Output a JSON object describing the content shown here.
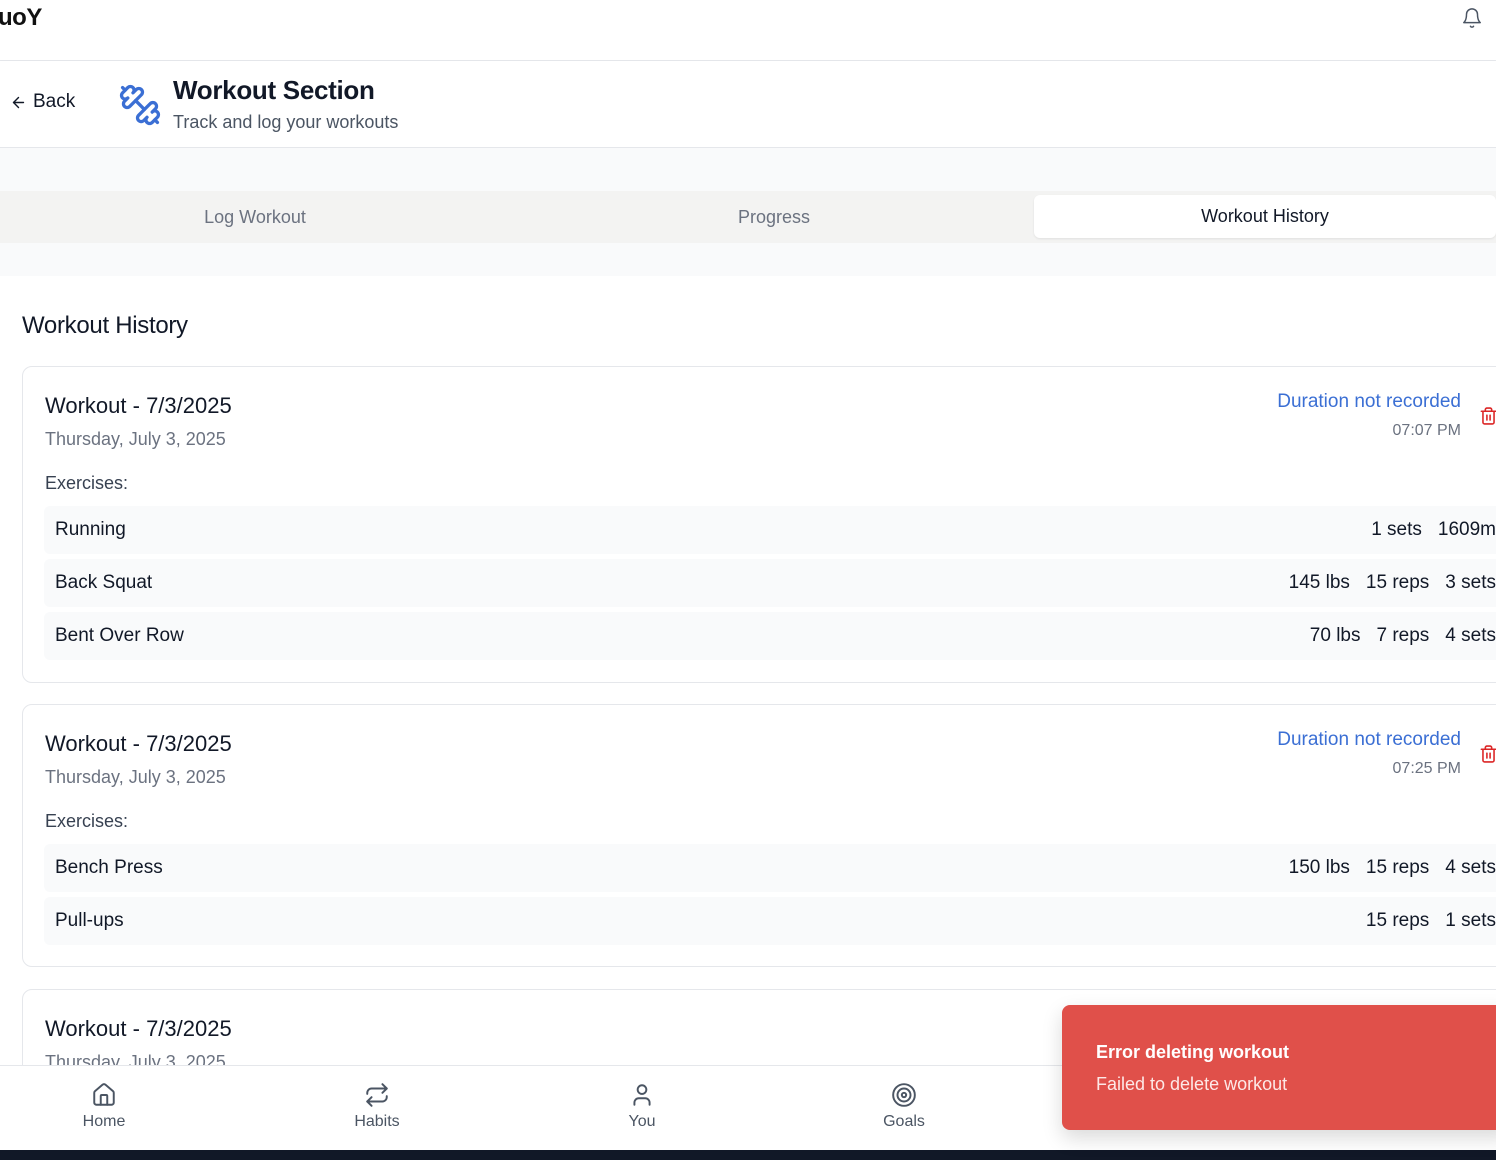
{
  "app": {
    "brand": "uoY"
  },
  "header": {
    "back_label": "Back",
    "title": "Workout Section",
    "subtitle": "Track and log your workouts"
  },
  "tabs": [
    {
      "label": "Log Workout",
      "active": false
    },
    {
      "label": "Progress",
      "active": false
    },
    {
      "label": "Workout History",
      "active": true
    }
  ],
  "history": {
    "title": "Workout History",
    "exercises_label": "Exercises:",
    "workouts": [
      {
        "title": "Workout - 7/3/2025",
        "date": "Thursday, July 3, 2025",
        "duration": "Duration not recorded",
        "time": "07:07 PM",
        "exercises": [
          {
            "name": "Running",
            "stats": [
              "1 sets",
              "1609m"
            ]
          },
          {
            "name": "Back Squat",
            "stats": [
              "145 lbs",
              "15 reps",
              "3 sets"
            ]
          },
          {
            "name": "Bent Over Row",
            "stats": [
              "70 lbs",
              "7 reps",
              "4 sets"
            ]
          }
        ]
      },
      {
        "title": "Workout - 7/3/2025",
        "date": "Thursday, July 3, 2025",
        "duration": "Duration not recorded",
        "time": "07:25 PM",
        "exercises": [
          {
            "name": "Bench Press",
            "stats": [
              "150 lbs",
              "15 reps",
              "4 sets"
            ]
          },
          {
            "name": "Pull-ups",
            "stats": [
              "15 reps",
              "1 sets"
            ]
          }
        ]
      },
      {
        "title": "Workout - 7/3/2025",
        "date": "Thursday, July 3, 2025"
      }
    ]
  },
  "bottom_nav": [
    {
      "label": "Home",
      "icon": "home-icon"
    },
    {
      "label": "Habits",
      "icon": "repeat-icon"
    },
    {
      "label": "You",
      "icon": "user-icon"
    },
    {
      "label": "Goals",
      "icon": "target-icon"
    }
  ],
  "toast": {
    "title": "Error deleting workout",
    "message": "Failed to delete workout",
    "color": "#e0504a"
  },
  "colors": {
    "accent": "#3b6fd4",
    "danger": "#dc2626"
  }
}
